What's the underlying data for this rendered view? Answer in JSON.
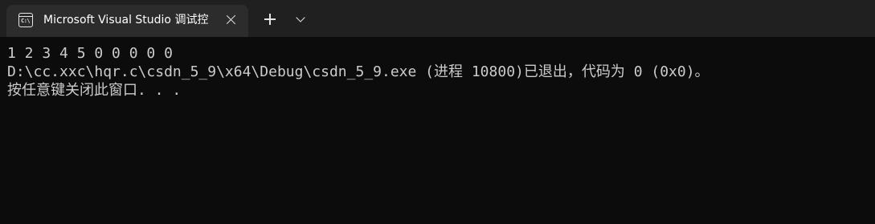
{
  "tab": {
    "icon": "terminal-icon",
    "icon_text": "C:\\",
    "title": "Microsoft Visual Studio 调试控",
    "close_icon": "close-icon"
  },
  "toolbar": {
    "new_tab_icon": "plus-icon",
    "dropdown_icon": "chevron-down-icon"
  },
  "console": {
    "lines": [
      "1 2 3 4 5 0 0 0 0 0",
      "D:\\cc.xxc\\hqr.c\\csdn_5_9\\x64\\Debug\\csdn_5_9.exe (进程 10800)已退出，代码为 0 (0x0)。",
      "按任意键关闭此窗口. . ."
    ]
  },
  "colors": {
    "tabbar_bg": "#202020",
    "tab_bg": "#2c2c2c",
    "console_bg": "#0c0c0c",
    "console_text": "#cccccc"
  }
}
